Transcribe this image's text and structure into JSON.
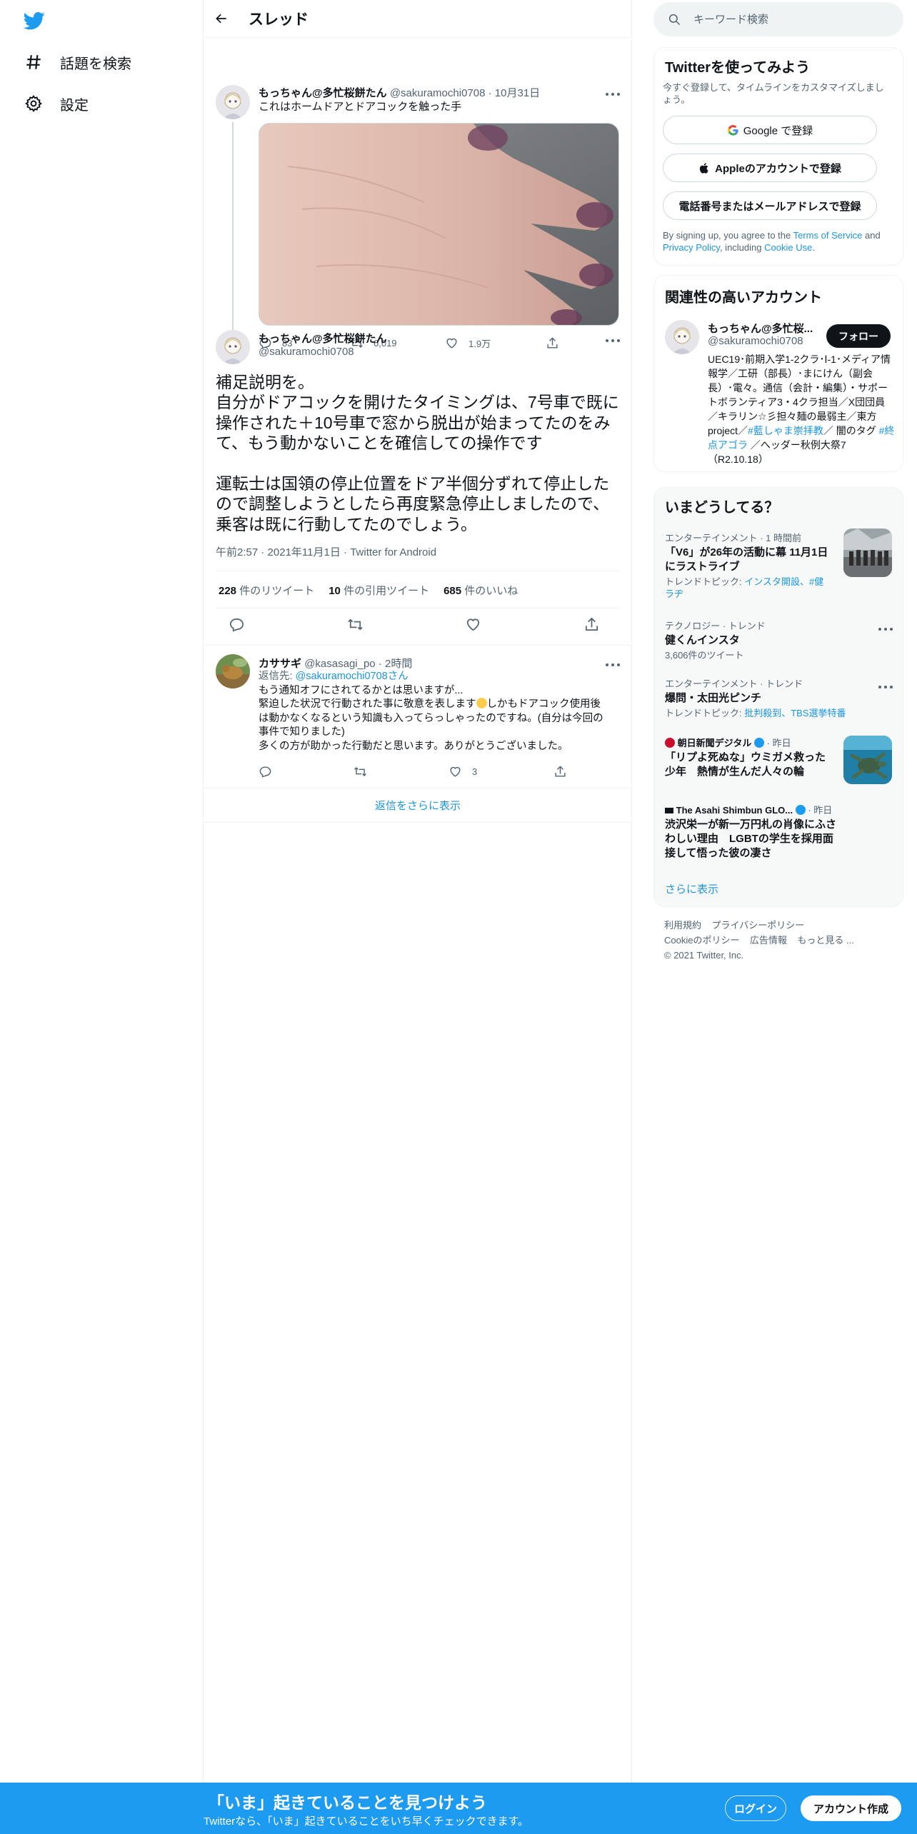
{
  "nav": {
    "logo_icon": "twitter-bird-icon",
    "items": [
      {
        "label": "話題を検索",
        "icon": "hashtag-icon"
      },
      {
        "label": "設定",
        "icon": "gear-icon"
      }
    ]
  },
  "header": {
    "title": "スレッド",
    "back_icon": "arrow-left-icon"
  },
  "tweet1": {
    "name": "もっちゃん@多忙桜餅たん",
    "handle": "@sakuramochi0708",
    "sep": "·",
    "date": "10月31日",
    "text": "これはホームドアとドアコックを触った手",
    "replies": "83",
    "retweets": "6,019",
    "likes": "1.9万"
  },
  "focus": {
    "name": "もっちゃん@多忙桜餅たん",
    "handle": "@sakuramochi0708",
    "body": "補足説明を。\n自分がドアコックを開けたタイミングは、7号車で既に操作された＋10号車で窓から脱出が始まってたのをみて、もう動かないことを確信しての操作です\n\n運転士は国領の停止位置をドア半個分ずれて停止したので調整しようとしたら再度緊急停止しましたので、乗客は既に行動してたのでしょう。",
    "time": "午前2:57",
    "sep1": "·",
    "date": "2021年11月1日",
    "sep2": "·",
    "source": "Twitter for Android",
    "retweets_count": "228",
    "retweets_label": "件のリツイート",
    "quotes_count": "10",
    "quotes_label": "件の引用ツイート",
    "likes_count": "685",
    "likes_label": "件のいいね"
  },
  "reply": {
    "name": "カササギ",
    "handle": "@kasasagi_po",
    "sep": "·",
    "time": "2時間",
    "reply_to_prefix": "返信先: ",
    "reply_to_handle": "@sakuramochi0708",
    "reply_to_suffix": "さん",
    "line1": "もう通知オフにされてるかとは思いますが...",
    "line2a": "緊迫した状況で行動された事に敬意を表します",
    "line2b": "しかもドアコック使用後",
    "line3": "は動かなくなるという知識も入ってらっしゃったのですね。(自分は今回の",
    "line4": "事件で知りました)",
    "line5": "多くの方が助かった行動だと思います。ありがとうございました。",
    "likes": "3",
    "show_more": "返信をさらに表示"
  },
  "search": {
    "placeholder": "キーワード検索"
  },
  "signup": {
    "title": "Twitterを使ってみよう",
    "desc": "今すぐ登録して、タイムラインをカスタマイズしましょう。",
    "google": "Google で登録",
    "apple": "Appleのアカウントで登録",
    "phone": "電話番号またはメールアドレスで登録",
    "legal_1": "By signing up, you agree to the ",
    "legal_terms": "Terms of Service",
    "legal_2": " and ",
    "legal_privacy": "Privacy Policy",
    "legal_3": ", including ",
    "legal_cookie": "Cookie Use",
    "legal_4": "."
  },
  "accounts": {
    "title": "関連性の高いアカウント",
    "name": "もっちゃん@多忙桜...",
    "handle": "@sakuramochi0708",
    "follow": "フォロー",
    "bio_1": "UEC19･前期入学1-2クラ･Ⅰ-1･メディア情報学／工研（部長）･まにけん（副会長）･電々。通信（会計・編集）・サポートボランティア3・4クラ担当／X団団員／キラリン☆彡担々麺の最弱主／東方project／",
    "bio_tag1": "#藍しゃま崇拝教",
    "bio_2": "／ 闇のタグ ",
    "bio_tag2": "#終点アゴラ",
    "bio_3": " ／へッダー秋例大祭7（R2.10.18）"
  },
  "trends": {
    "title": "いまどうしてる？",
    "items": [
      {
        "category": "エンターテインメント · 1 時間前",
        "title": "「V6」が26年の活動に幕 11月1日にラストライブ",
        "sub_prefix": "トレンドトピック: ",
        "sub_links": "インスタ開設、#健ラヂ"
      },
      {
        "category": "テクノロジー · トレンド",
        "title": "健くんインスタ",
        "sub": "3,606件のツイート"
      },
      {
        "category": "エンターテインメント · トレンド",
        "title": "爆問・太田光ピンチ",
        "sub_prefix": "トレンドトピック: ",
        "sub_links": "批判殺到、TBS選挙特番"
      },
      {
        "source": "朝日新聞デジタル",
        "time": "· 昨日",
        "title": "「リプよ死ぬな」ウミガメ救った少年　熱情が生んだ人々の輪"
      },
      {
        "source": "The Asahi Shimbun GLO...",
        "time": "· 昨日",
        "title": "渋沢栄一が新一万円札の肖像にふさわしい理由　LGBTの学生を採用面接して悟った彼の凄さ"
      }
    ],
    "show_more": "さらに表示"
  },
  "footer": {
    "terms": "利用規約",
    "privacy": "プライバシーポリシー",
    "cookie": "Cookieのポリシー",
    "ads": "広告情報",
    "more": "もっと見る ...",
    "copyright": "© 2021 Twitter, Inc."
  },
  "banner": {
    "title": "「いま」起きていることを見つけよう",
    "sub": "Twitterなら、「いま」起きていることをいち早くチェックできます。",
    "login": "ログイン",
    "signup": "アカウント作成"
  },
  "colors": {
    "accent": "#1d9bf0",
    "link": "#1b95e0",
    "text": "#0f1419",
    "muted": "#536471"
  }
}
